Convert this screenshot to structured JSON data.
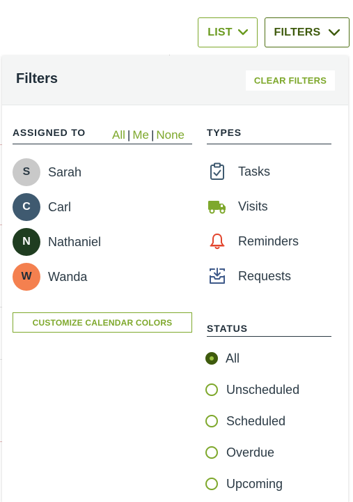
{
  "toolbar": {
    "list_label": "LIST",
    "filters_label": "FILTERS"
  },
  "panel": {
    "title": "Filters",
    "clear_label": "CLEAR FILTERS"
  },
  "assigned": {
    "title": "ASSIGNED TO",
    "links": {
      "all": "All",
      "me": "Me",
      "none": "None",
      "sep": "|"
    },
    "people": [
      {
        "initial": "S",
        "name": "Sarah",
        "color": "#c9c9c9",
        "text_color": "#2b3a45"
      },
      {
        "initial": "C",
        "name": "Carl",
        "color": "#3f5a70",
        "text_color": "#ffffff"
      },
      {
        "initial": "N",
        "name": "Nathaniel",
        "color": "#1f3d20",
        "text_color": "#ffffff"
      },
      {
        "initial": "W",
        "name": "Wanda",
        "color": "#f4804f",
        "text_color": "#1f2d38"
      }
    ],
    "customize_label": "CUSTOMIZE CALENDAR COLORS"
  },
  "types": {
    "title": "TYPES",
    "items": [
      {
        "label": "Tasks",
        "icon": "clipboard-check-icon",
        "color": "#3f5a70"
      },
      {
        "label": "Visits",
        "icon": "truck-icon",
        "color": "#7ea82c"
      },
      {
        "label": "Reminders",
        "icon": "bell-icon",
        "color": "#e2452d"
      },
      {
        "label": "Requests",
        "icon": "inbox-download-icon",
        "color": "#3f5a8a"
      }
    ]
  },
  "status": {
    "title": "STATUS",
    "options": [
      {
        "label": "All",
        "checked": true
      },
      {
        "label": "Unscheduled",
        "checked": false
      },
      {
        "label": "Scheduled",
        "checked": false
      },
      {
        "label": "Overdue",
        "checked": false
      },
      {
        "label": "Upcoming",
        "checked": false
      }
    ]
  },
  "colors": {
    "accent": "#7ea82c",
    "accent_dark": "#3e5a0d",
    "heading": "#1f2d38"
  }
}
